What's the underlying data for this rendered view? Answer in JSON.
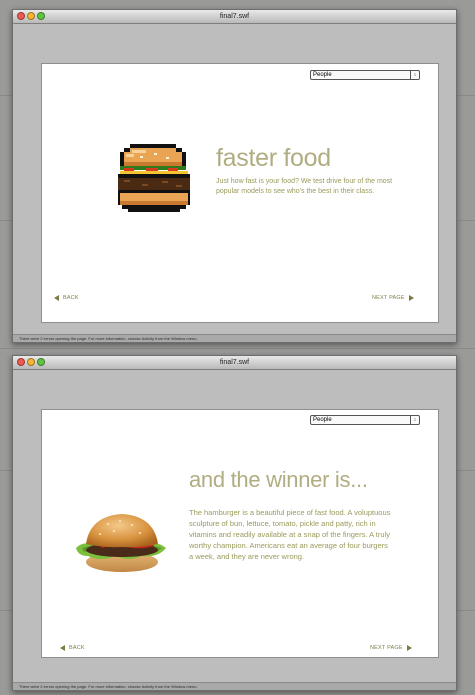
{
  "window_title": "final7.swf",
  "status_message": "There were 2 errors opening the page. For more information, choose Activity from the Window menu.",
  "dropdown_value": "People",
  "nav": {
    "back": "BACK",
    "next": "NEXT PAGE"
  },
  "slides": [
    {
      "headline": "faster food",
      "body": "Just how fast is your food? We test drive four of the most popular models to see who's the best in their class.",
      "image": "pixel-burger-icon"
    },
    {
      "headline": "and the winner is...",
      "body": "The hamburger is a beautiful piece of fast food. A voluptuous sculpture of bun, lettuce, tomato, pickle and patty, rich in vitamins and readily available at a snap of the fingers. A truly worthy champion. Americans eat an average of four burgers a week, and they are never wrong.",
      "image": "hamburger-photo"
    }
  ]
}
